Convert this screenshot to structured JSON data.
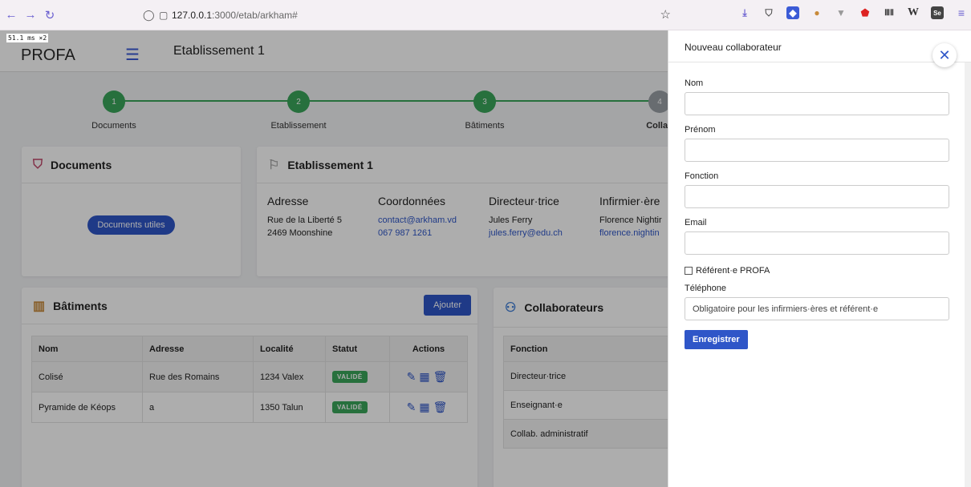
{
  "browser": {
    "url_host": "127.0.0.1",
    "url_path": ":3000/etab/arkham#",
    "extensions": [
      "download-icon",
      "shield-ext-icon",
      "shield-blue-ext-icon",
      "cookie-ext-icon",
      "vue-ext-icon",
      "ublock-ext-icon",
      "bars-ext-icon",
      "wiki-ext-icon",
      "se-ext-icon",
      "menu-icon"
    ],
    "extension_labels": {
      "wiki": "W",
      "se": "Se",
      "bars": "ⅢⅡ"
    }
  },
  "perf": "51.1 ms ×2",
  "app": {
    "brand": "PROFA",
    "title": "Etablissement 1",
    "steps": [
      {
        "n": "1",
        "label": "Documents"
      },
      {
        "n": "2",
        "label": "Etablissement"
      },
      {
        "n": "3",
        "label": "Bâtiments"
      },
      {
        "n": "4",
        "label": "Collab"
      }
    ],
    "documents": {
      "title": "Documents",
      "button": "Documents utiles"
    },
    "etab": {
      "title": "Etablissement 1",
      "address_h": "Adresse",
      "address_1": "Rue de la Liberté 5",
      "address_2": "2469 Moonshine",
      "coord_h": "Coordonnées",
      "coord_email": "contact@arkham.vd",
      "coord_phone": "067 987 1261",
      "dir_h": "Directeur·trice",
      "dir_name": "Jules Ferry",
      "dir_email": "jules.ferry@edu.ch",
      "inf_h": "Infirmier·ère",
      "inf_name": "Florence Nightir",
      "inf_email": "florence.nightin"
    },
    "batiments": {
      "title": "Bâtiments",
      "add": "Ajouter",
      "headers": [
        "Nom",
        "Adresse",
        "Localité",
        "Statut",
        "Actions"
      ],
      "rows": [
        {
          "nom": "Colisé",
          "adresse": "Rue des Romains",
          "localite": "1234 Valex",
          "statut": "VALIDÉ"
        },
        {
          "nom": "Pyramide de Kéops",
          "adresse": "a",
          "localite": "1350 Talun",
          "statut": "VALIDÉ"
        }
      ]
    },
    "collab": {
      "title": "Collaborateurs",
      "header": "Fonction",
      "rows": [
        "Directeur·trice",
        "Enseignant·e",
        "Collab. administratif"
      ]
    }
  },
  "drawer": {
    "title": "Nouveau collaborateur",
    "nom": "Nom",
    "prenom": "Prénom",
    "fonction": "Fonction",
    "email": "Email",
    "referent": "Référent·e PROFA",
    "telephone": "Téléphone",
    "telephone_placeholder": "Obligatoire pour les infirmiers·ères et référent·e",
    "submit": "Enregistrer"
  }
}
